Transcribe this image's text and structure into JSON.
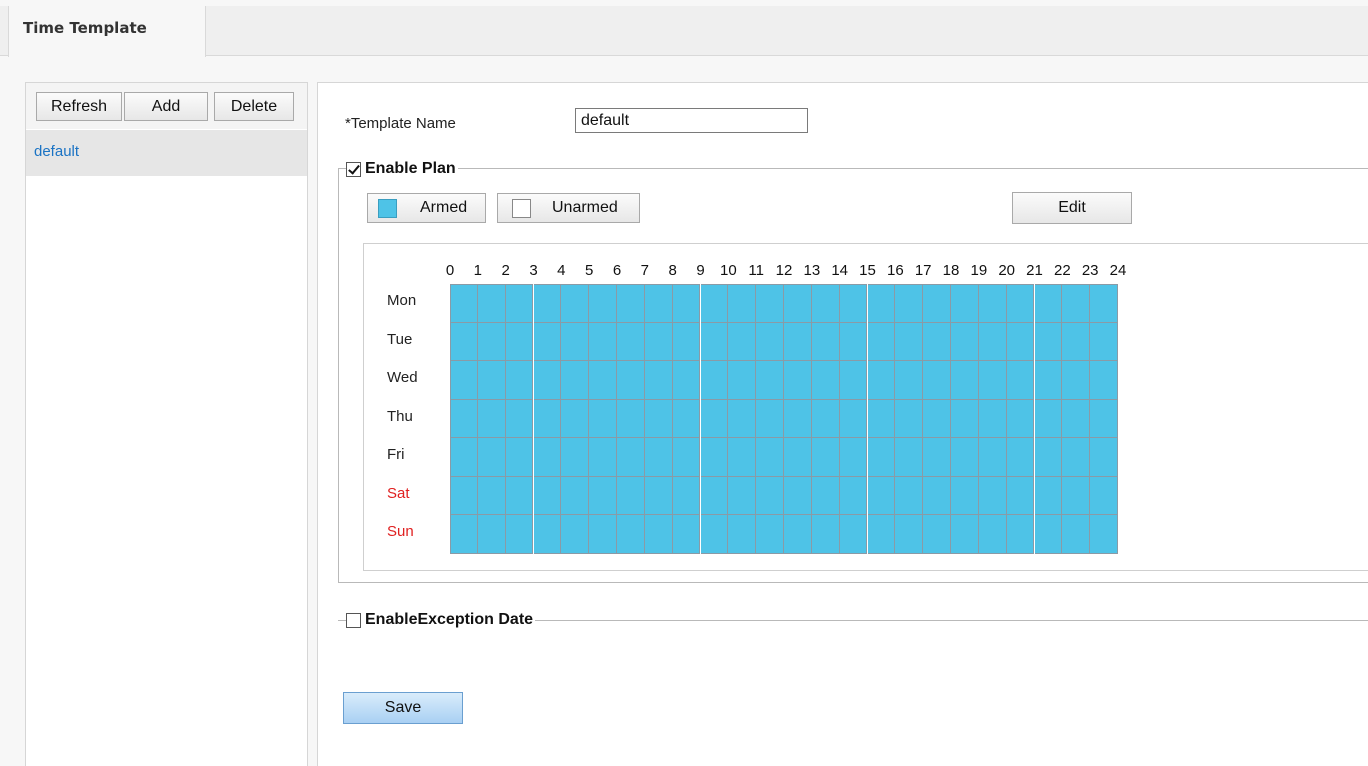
{
  "tab": {
    "label": "Time Template"
  },
  "left": {
    "buttons": {
      "refresh": "Refresh",
      "add": "Add",
      "delete": "Delete"
    },
    "items": [
      {
        "label": "default",
        "selected": true
      }
    ]
  },
  "form": {
    "template_name_label": "*Template Name",
    "template_name_value": "default",
    "enable_plan_label": "Enable Plan",
    "enable_plan_checked": true,
    "armed_label": "Armed",
    "unarmed_label": "Unarmed",
    "edit_label": "Edit",
    "hours": [
      "0",
      "1",
      "2",
      "3",
      "4",
      "5",
      "6",
      "7",
      "8",
      "9",
      "10",
      "11",
      "12",
      "13",
      "14",
      "15",
      "16",
      "17",
      "18",
      "19",
      "20",
      "21",
      "22",
      "23",
      "24"
    ],
    "days": [
      {
        "label": "Mon",
        "weekend": false
      },
      {
        "label": "Tue",
        "weekend": false
      },
      {
        "label": "Wed",
        "weekend": false
      },
      {
        "label": "Thu",
        "weekend": false
      },
      {
        "label": "Fri",
        "weekend": false
      },
      {
        "label": "Sat",
        "weekend": true
      },
      {
        "label": "Sun",
        "weekend": true
      }
    ],
    "schedule_state": "armed-all-hours",
    "enable_exception_label": "EnableException Date",
    "enable_exception_checked": false,
    "save_label": "Save"
  },
  "colors": {
    "armed": "#4ec3e7",
    "weekend_text": "#e02020",
    "link": "#1a73c4"
  }
}
